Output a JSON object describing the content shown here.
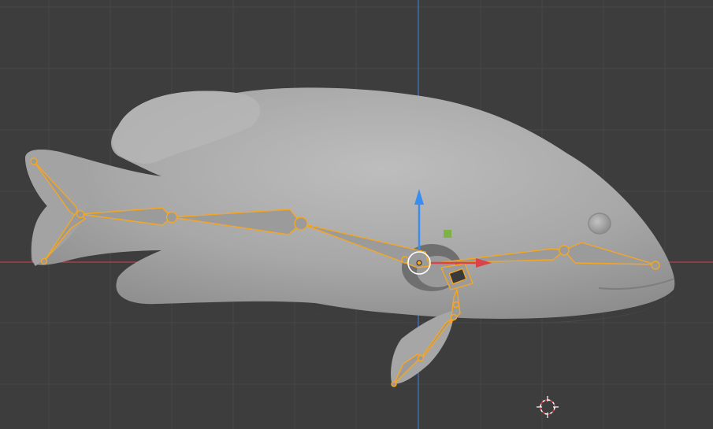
{
  "viewport": {
    "background": "#3d3d3d",
    "grid_color": "#474747",
    "x_axis_color": "#b5424a",
    "z_axis_color": "#3b7ad1"
  },
  "object": {
    "type": "mesh",
    "shape": "fish",
    "mesh_color": "#a9a9a9"
  },
  "armature": {
    "selected": true,
    "outline_color": "#f5a623",
    "bone_fill": "#9b9b9b",
    "bone_count": 9
  },
  "gizmo": {
    "mode": "move",
    "x_arrow_color": "#d9434b",
    "y_handle_color": "#7cb342",
    "z_arrow_color": "#3a8df0",
    "pivot_color": "#ffffff"
  },
  "cursor_3d": {
    "icon": "3d-cursor-icon",
    "colors": [
      "#ffffff",
      "#d9434b"
    ]
  }
}
